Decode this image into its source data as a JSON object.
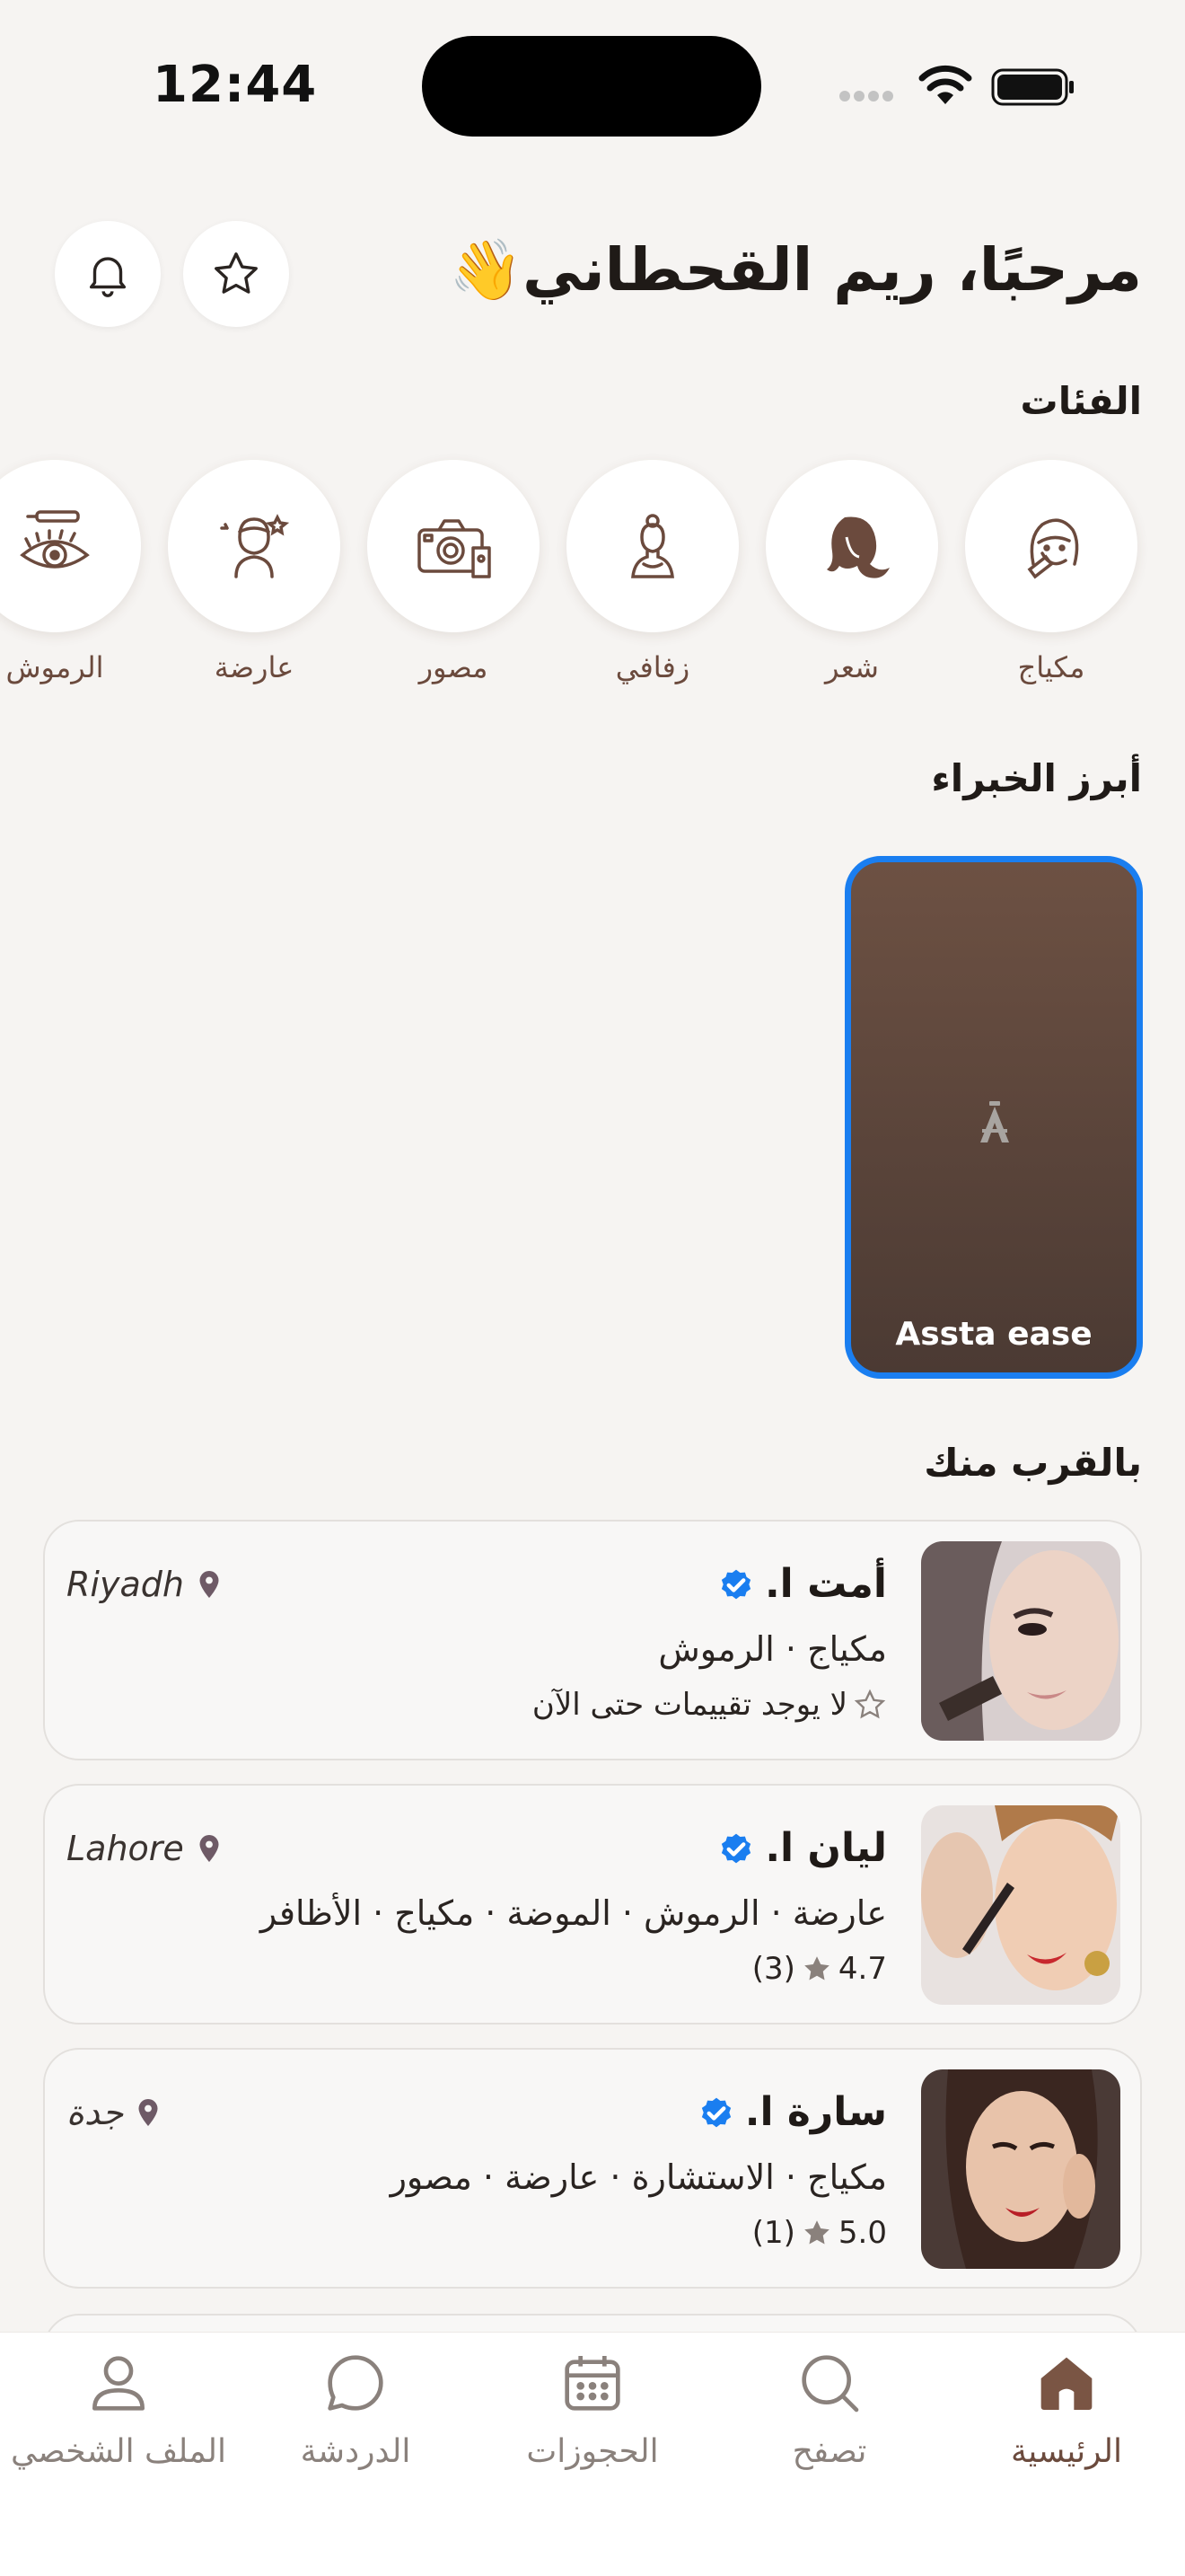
{
  "status_bar": {
    "time": "12:44"
  },
  "header": {
    "greeting": "مرحبًا، ريم القحطاني👋",
    "favorites_icon": "star-icon",
    "notifications_icon": "bell-icon"
  },
  "categories": {
    "title": "الفئات",
    "items": [
      {
        "label": "مكياج",
        "icon": "makeup-icon"
      },
      {
        "label": "شعر",
        "icon": "hair-icon"
      },
      {
        "label": "زفافي",
        "icon": "bridal-icon"
      },
      {
        "label": "مصور",
        "icon": "camera-icon"
      },
      {
        "label": "عارضة",
        "icon": "model-icon"
      },
      {
        "label": "الرموش",
        "icon": "lashes-icon"
      }
    ]
  },
  "featured": {
    "title": "أبرز الخبراء",
    "items": [
      {
        "name": "Assta ease"
      }
    ]
  },
  "nearby": {
    "title": "بالقرب منك",
    "items": [
      {
        "name": "أمت ا.",
        "categories": "مكياج · الرموش",
        "rating": "لا يوجد تقييمات حتى الآن",
        "city": "Riyadh"
      },
      {
        "name": "ليان ا.",
        "categories": "عارضة · الرموش · الموضة · مكياج · الأظافر",
        "rating": "4.7",
        "reviews": "(3)",
        "city": "Lahore"
      },
      {
        "name": "سارة ا.",
        "categories": "مكياج · الاستشارة · عارضة · مصور",
        "rating": "5.0",
        "reviews": "(1)",
        "city": "جدة"
      }
    ]
  },
  "nav": {
    "items": [
      {
        "label": "الرئيسية",
        "icon": "home-icon",
        "active": true
      },
      {
        "label": "تصفح",
        "icon": "search-icon",
        "active": false
      },
      {
        "label": "الحجوزات",
        "icon": "calendar-icon",
        "active": false
      },
      {
        "label": "الدردشة",
        "icon": "chat-icon",
        "active": false
      },
      {
        "label": "الملف الشخصي",
        "icon": "profile-icon",
        "active": false
      }
    ]
  },
  "colors": {
    "accent": "#6b4a3d",
    "verified": "#1a7ef0",
    "background": "#f6f4f2"
  }
}
